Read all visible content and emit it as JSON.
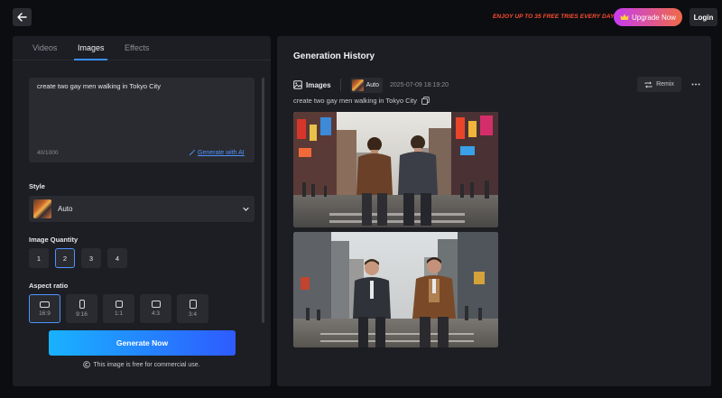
{
  "topbar": {
    "promo_text": "ENJOY UP TO 35 FREE TRIES EVERY DAY!",
    "upgrade_label": "Upgrade Now",
    "login_label": "Login"
  },
  "left_panel": {
    "tabs": [
      {
        "label": "Videos",
        "active": false
      },
      {
        "label": "Images",
        "active": true
      },
      {
        "label": "Effects",
        "active": false
      }
    ],
    "prompt": {
      "value": "create two gay men walking in Tokyo City",
      "char_count": "40/1000",
      "generate_ai_label": "Generate with AI"
    },
    "style": {
      "label": "Style",
      "value": "Auto"
    },
    "quantity": {
      "label": "Image Quantity",
      "options": [
        "1",
        "2",
        "3",
        "4"
      ],
      "selected": "2"
    },
    "aspect_ratio": {
      "label": "Aspect ratio",
      "options": [
        "16:9",
        "9:16",
        "1:1",
        "4:3",
        "3:4"
      ],
      "selected": "16:9"
    },
    "generate_label": "Generate Now",
    "free_note": "This image is free for commercial use."
  },
  "history": {
    "title": "Generation History",
    "type_label": "Images",
    "style_label": "Auto",
    "timestamp": "2025-07-09 18:19:20",
    "remix_label": "Remix",
    "prompt": "create two gay men walking in Tokyo City"
  },
  "icons": {
    "back": "arrow-left-icon",
    "upgrade": "crown-icon",
    "generate_ai": "magic-wand-icon",
    "style_chevron": "chevron-down-icon",
    "images": "image-icon",
    "remix": "repeat-icon",
    "more": "more-horizontal-icon",
    "copy": "copy-icon",
    "free": "copyright-icon"
  },
  "colors": {
    "accent": "#4d93ff",
    "promo": "#ff4d2e",
    "generate_start": "#19b2ff",
    "generate_end": "#2e5bff"
  }
}
